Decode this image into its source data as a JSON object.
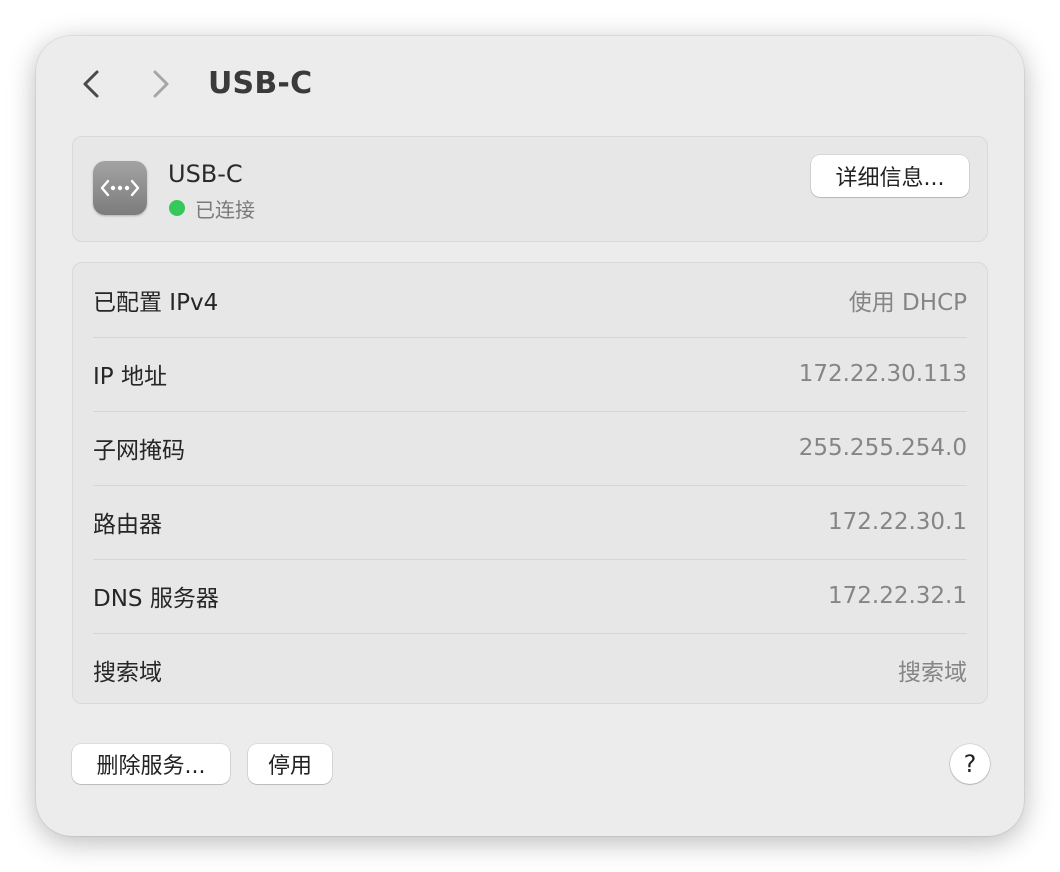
{
  "header": {
    "title": "USB-C",
    "back_icon": "chevron-left-icon",
    "forward_icon": "chevron-right-icon"
  },
  "service": {
    "icon": "ethernet-dots-icon",
    "name": "USB-C",
    "status": "已连接",
    "status_color": "#35c85a",
    "details_button": "详细信息..."
  },
  "info_rows": [
    {
      "label": "已配置 IPv4",
      "value": "使用 DHCP"
    },
    {
      "label": "IP 地址",
      "value": "172.22.30.113"
    },
    {
      "label": "子网掩码",
      "value": "255.255.254.0"
    },
    {
      "label": "路由器",
      "value": "172.22.30.1"
    },
    {
      "label": "DNS 服务器",
      "value": "172.22.32.1"
    },
    {
      "label": "搜索域",
      "value": "搜索域"
    }
  ],
  "footer": {
    "delete_button": "删除服务...",
    "disable_button": "停用",
    "help_button": "?"
  }
}
